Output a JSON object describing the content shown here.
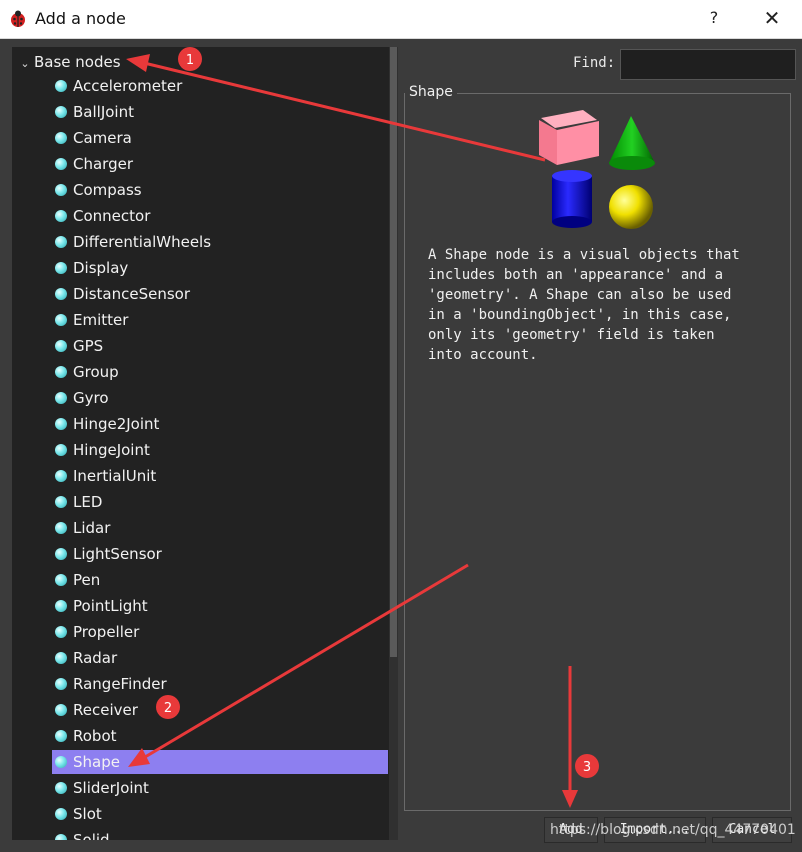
{
  "window": {
    "title": "Add a node",
    "help_label": "?",
    "close_label": "✕"
  },
  "tree": {
    "root_label": "Base nodes",
    "items": [
      "Accelerometer",
      "BallJoint",
      "Camera",
      "Charger",
      "Compass",
      "Connector",
      "DifferentialWheels",
      "Display",
      "DistanceSensor",
      "Emitter",
      "GPS",
      "Group",
      "Gyro",
      "Hinge2Joint",
      "HingeJoint",
      "InertialUnit",
      "LED",
      "Lidar",
      "LightSensor",
      "Pen",
      "PointLight",
      "Propeller",
      "Radar",
      "RangeFinder",
      "Receiver",
      "Robot",
      "Shape",
      "SliderJoint",
      "Slot",
      "Solid"
    ],
    "selected": "Shape"
  },
  "find": {
    "label": "Find:",
    "value": ""
  },
  "detail": {
    "title": "Shape",
    "description": "A Shape node is a visual objects that\nincludes both an 'appearance' and a\n'geometry'. A Shape can also be used\nin a 'boundingObject', in this case,\nonly its 'geometry' field is taken\ninto account."
  },
  "buttons": {
    "add": "Add",
    "import": "Import...",
    "cancel": "Cancel"
  },
  "annotations": {
    "one": "1",
    "two": "2",
    "three": "3"
  },
  "watermark": "https://blog.csdn.net/qq_44770401",
  "colors": {
    "selection": "#8d7ff0",
    "annotation": "#e8393a",
    "background": "#3b3b3b"
  }
}
